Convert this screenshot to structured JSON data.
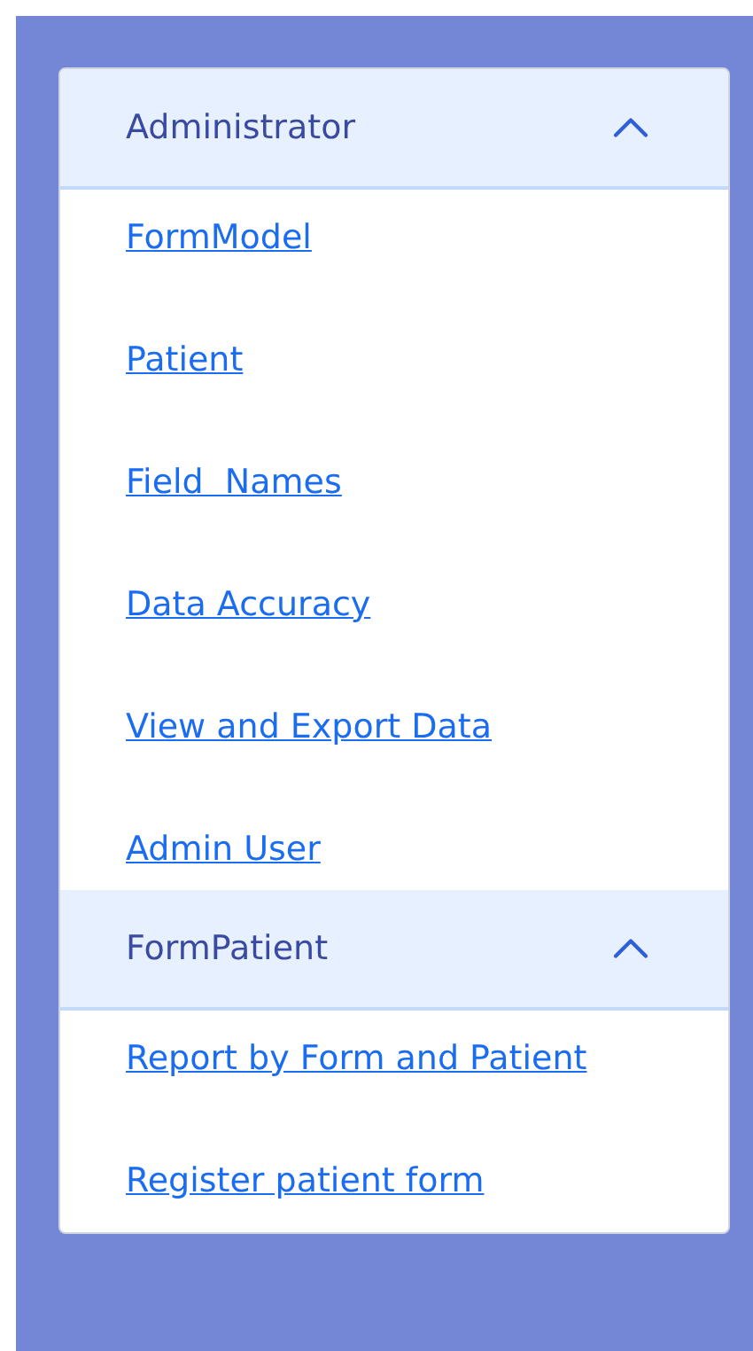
{
  "sections": [
    {
      "title": "Administrator",
      "expanded": true,
      "links": [
        "FormModel",
        "Patient",
        "Field  Names",
        "Data Accuracy",
        "View and Export Data",
        "Admin User"
      ]
    },
    {
      "title": "FormPatient",
      "expanded": true,
      "links": [
        "Report by Form and Patient",
        "Register patient form"
      ]
    }
  ]
}
